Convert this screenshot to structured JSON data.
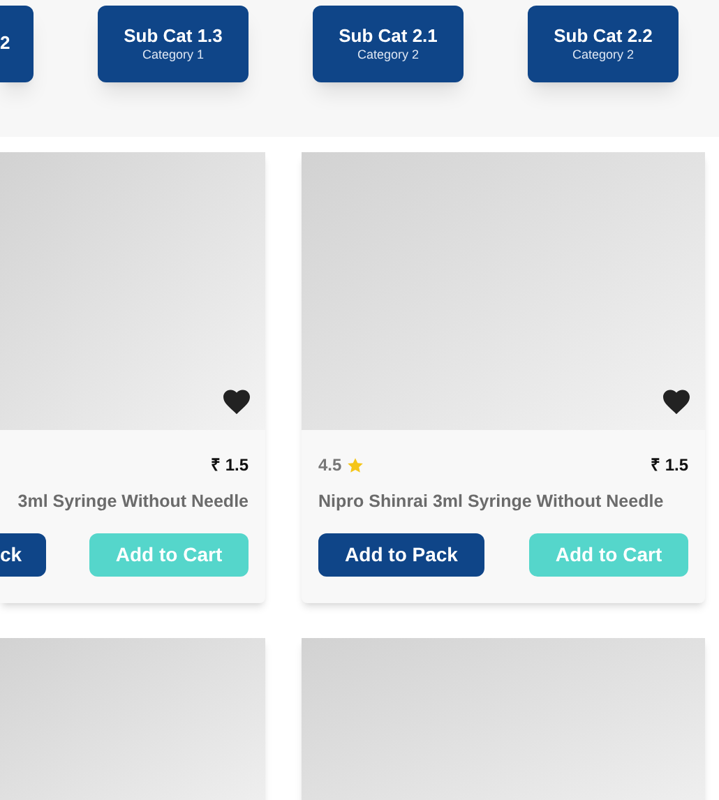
{
  "subcategories": [
    {
      "name": "2"
    },
    {
      "name": "Sub Cat 1.3",
      "category": "Category 1"
    },
    {
      "name": "Sub Cat 2.1",
      "category": "Category 2"
    },
    {
      "name": "Sub Cat 2.2",
      "category": "Category 2"
    }
  ],
  "products": [
    {
      "kind": "card",
      "price": "₹ 1.5",
      "name": "3ml Syringe Without Needle",
      "pack_button": "ck",
      "cart_button": "Add to Cart"
    },
    {
      "kind": "card",
      "rating": "4.5",
      "price": "₹ 1.5",
      "name": "Nipro Shinrai 3ml Syringe Without Needle",
      "pack_button": "Add to Pack",
      "cart_button": "Add to Cart"
    },
    {
      "kind": "image_only"
    },
    {
      "kind": "image_only"
    }
  ]
}
